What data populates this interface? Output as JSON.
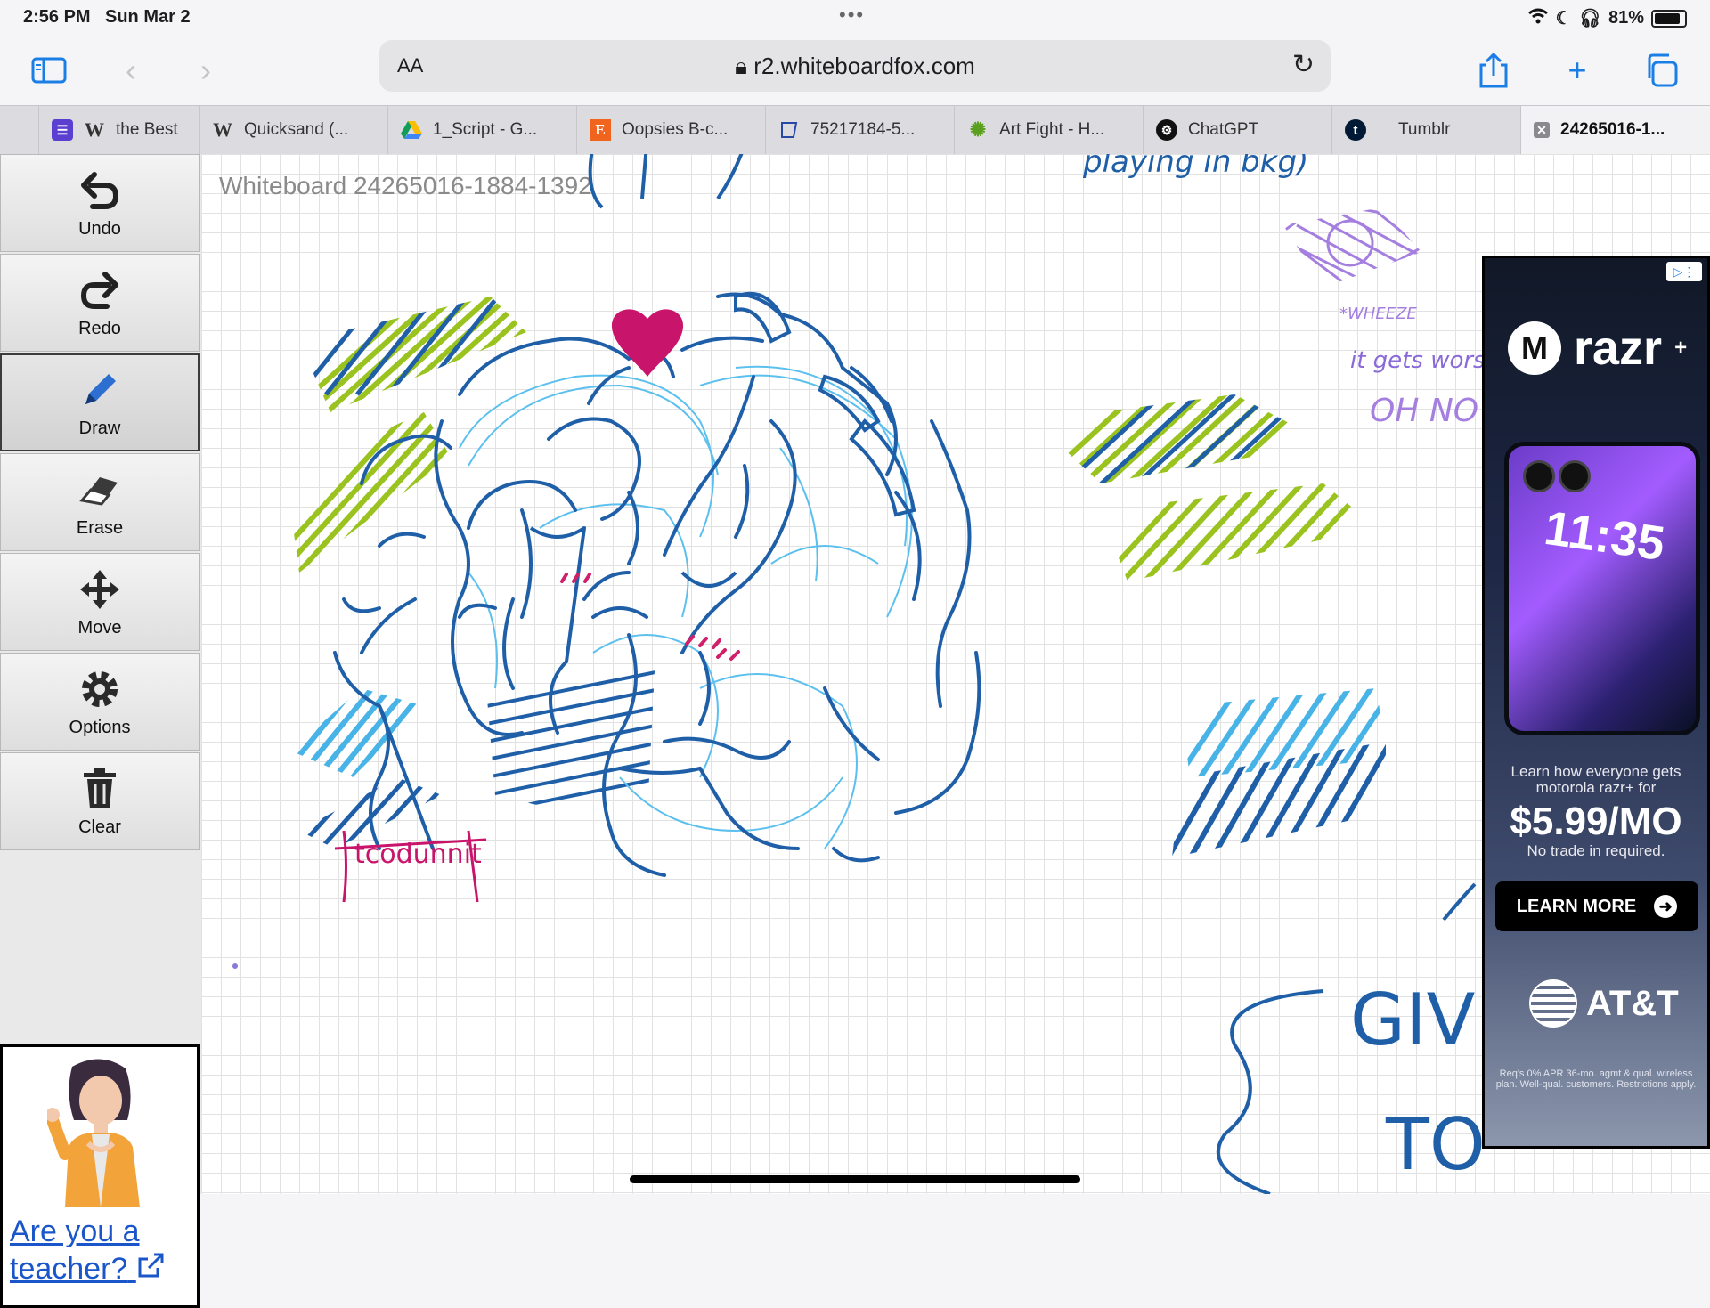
{
  "status_bar": {
    "time": "2:56 PM",
    "date": "Sun Mar 2",
    "battery": "81%"
  },
  "browser": {
    "text_size_label": "AA",
    "url": "r2.whiteboardfox.com",
    "tabs": [
      {
        "label": "the Best",
        "icon": "wikipedia-icon"
      },
      {
        "label": "Quicksand (...",
        "icon": "wikipedia-icon"
      },
      {
        "label": "1_Script - G...",
        "icon": "google-drive-icon"
      },
      {
        "label": "Oopsies B-c...",
        "icon": "etsy-icon"
      },
      {
        "label": "75217184-5...",
        "icon": "whiteboard-icon"
      },
      {
        "label": "Art Fight - H...",
        "icon": "art-fight-icon"
      },
      {
        "label": "ChatGPT",
        "icon": "chatgpt-icon"
      },
      {
        "label": "Tumblr",
        "icon": "tumblr-icon"
      },
      {
        "label": "24265016-1...",
        "icon": "close-icon"
      }
    ]
  },
  "tools": [
    {
      "label": "Undo",
      "icon": "undo-icon"
    },
    {
      "label": "Redo",
      "icon": "redo-icon"
    },
    {
      "label": "Draw",
      "icon": "pencil-icon",
      "selected": true
    },
    {
      "label": "Erase",
      "icon": "eraser-icon"
    },
    {
      "label": "Move",
      "icon": "move-icon"
    },
    {
      "label": "Options",
      "icon": "gear-icon"
    },
    {
      "label": "Clear",
      "icon": "trash-icon"
    }
  ],
  "teacher_promo": {
    "link_text": "Are you a teacher?",
    "icon": "external-link-icon"
  },
  "whiteboard": {
    "title": "Whiteboard 24265016-1884-1392",
    "handwriting": {
      "top_note": "playing in bkg)",
      "purple_note": "it gets worse",
      "purple_shout": "OH NO",
      "purple_caption": "*WHEEZE",
      "signature": "tcodunnit",
      "big_text_1": "GIVE",
      "big_text_2": "TO"
    }
  },
  "ad": {
    "brand": "razr",
    "brand_suffix": "+",
    "phone_time": "11:35",
    "headline": "Learn how everyone gets motorola razr+ for",
    "price": "$5.99/MO",
    "subtext": "No trade in required.",
    "cta": "LEARN MORE",
    "advertiser": "AT&T",
    "fine_print": "Req's 0% APR 36-mo. agmt & qual. wireless plan. Well-qual. customers. Restrictions apply."
  },
  "colors": {
    "accent": "#1a7ee6",
    "ink_dark_blue": "#1f5fa8",
    "ink_light_blue": "#48b3e6",
    "ink_green": "#9bc31f",
    "ink_purple": "#a57fe0",
    "ink_magenta": "#c8146a"
  }
}
